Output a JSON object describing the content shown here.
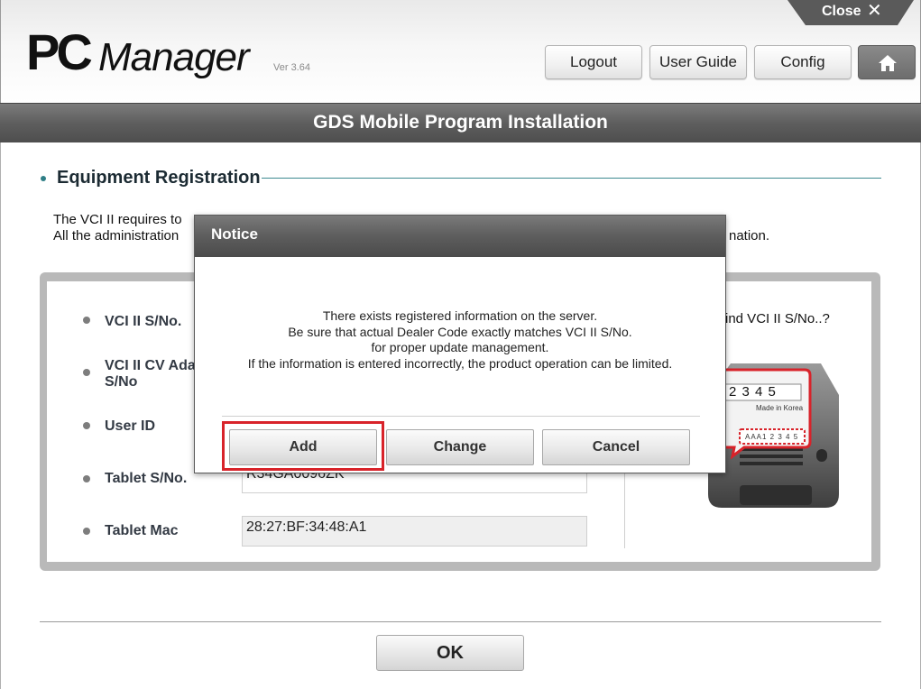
{
  "header": {
    "close_label": "Close",
    "close_icon": "✕",
    "logo_pc": "PC",
    "logo_manager": "Manager",
    "version": "Ver 3.64",
    "buttons": {
      "logout": "Logout",
      "user_guide": "User Guide",
      "config": "Config"
    }
  },
  "title": "GDS Mobile Program Installation",
  "section": {
    "title": "Equipment Registration",
    "desc_line1": "The VCI II requires to",
    "desc_line2": "All the administration",
    "desc_line2_end": "nation."
  },
  "form": {
    "rows": [
      {
        "label": "VCI II S/No.",
        "value": ""
      },
      {
        "label": "VCI II CV Ada\nS/No",
        "value": ""
      },
      {
        "label": "User ID",
        "value": ""
      },
      {
        "label": "Tablet S/No.",
        "value": "R34GA0096ZK"
      },
      {
        "label": "Tablet Mac",
        "value": "28:27:BF:34:48:A1"
      }
    ],
    "find_text": "ind VCI II S/No..?",
    "device_label_top": "2 3 4 5",
    "device_made_in": "Made in Korea",
    "device_serial": "AAA1 2 3 4 5"
  },
  "ok_button": "OK",
  "modal": {
    "title": "Notice",
    "message": [
      "There exists registered information on the server.",
      "Be sure that actual Dealer Code exactly matches VCI II S/No.",
      "for proper update management.",
      "If the information is entered incorrectly, the product operation can be limited."
    ],
    "buttons": {
      "add": "Add",
      "change": "Change",
      "cancel": "Cancel"
    }
  },
  "colors": {
    "highlight": "#d8232a",
    "accent_teal": "#2f7e86",
    "titlebar": "#5e5e5e"
  },
  "icons": {
    "home": "home-icon",
    "close": "close-icon"
  }
}
